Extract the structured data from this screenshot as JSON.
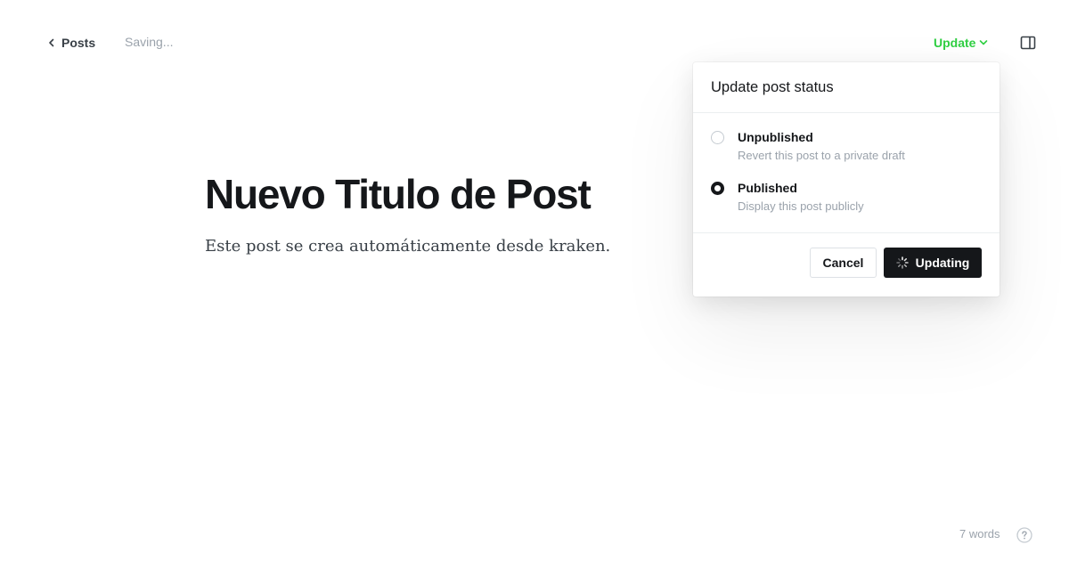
{
  "header": {
    "back_label": "Posts",
    "save_status": "Saving...",
    "update_label": "Update",
    "icons": {
      "back": "chevron-left-icon",
      "update": "chevron-down-icon",
      "sidebar": "sidebar-toggle-icon"
    }
  },
  "editor": {
    "title": "Nuevo Titulo de Post",
    "body": "Este post se crea automáticamente desde kraken."
  },
  "status_popup": {
    "heading": "Update post status",
    "options": [
      {
        "label": "Unpublished",
        "description": "Revert this post to a private draft",
        "selected": false
      },
      {
        "label": "Published",
        "description": "Display this post publicly",
        "selected": true
      }
    ],
    "cancel_label": "Cancel",
    "confirm_label": "Updating",
    "confirm_icon": "spinner-icon"
  },
  "footer": {
    "word_count": "7 words",
    "help_icon": "help-icon"
  },
  "colors": {
    "accent_green": "#30cf43",
    "text_dark": "#15171a",
    "text_muted": "#9aa2ab",
    "button_dark": "#15171a"
  }
}
